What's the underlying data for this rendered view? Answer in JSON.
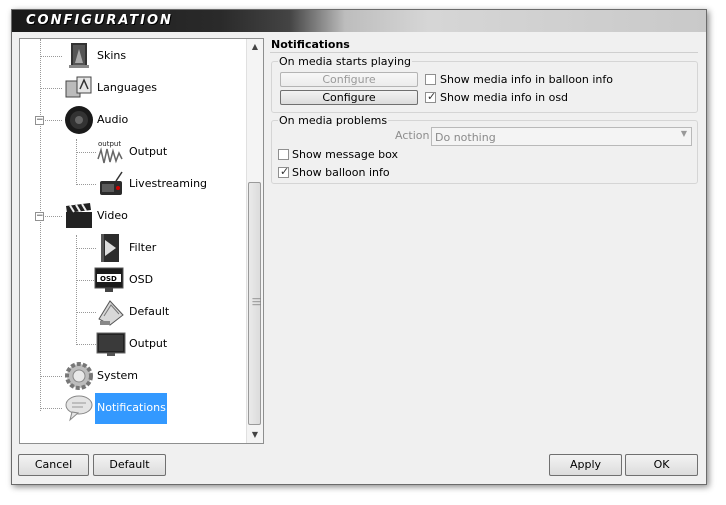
{
  "window": {
    "title": "CONFIGURATION"
  },
  "tree": {
    "items": [
      {
        "label": "Skins",
        "icon": "skins-icon"
      },
      {
        "label": "Languages",
        "icon": "languages-icon"
      },
      {
        "label": "Audio",
        "icon": "speaker-icon"
      },
      {
        "label": "Output",
        "icon": "audio-output-icon",
        "icon_text": "output"
      },
      {
        "label": "Livestreaming",
        "icon": "livestreaming-icon"
      },
      {
        "label": "Video",
        "icon": "clapperboard-icon"
      },
      {
        "label": "Filter",
        "icon": "filter-icon"
      },
      {
        "label": "OSD",
        "icon": "osd-icon",
        "icon_text": "OSD"
      },
      {
        "label": "Default",
        "icon": "default-icon"
      },
      {
        "label": "Output",
        "icon": "monitor-icon"
      },
      {
        "label": "System",
        "icon": "gear-icon"
      },
      {
        "label": "Notifications",
        "icon": "speech-bubble-icon"
      }
    ],
    "selected": "Notifications"
  },
  "notifications": {
    "title": "Notifications",
    "media_start": {
      "legend": "On media starts playing",
      "configure_label_1": "Configure",
      "configure_label_2": "Configure",
      "balloon_label": "Show media info in balloon info",
      "balloon_checked": false,
      "osd_label": "Show media info in osd",
      "osd_checked": true
    },
    "media_problems": {
      "legend": "On media problems",
      "action_label": "Action",
      "action_value": "Do nothing",
      "message_box_label": "Show message box",
      "message_box_checked": false,
      "balloon_label": "Show balloon info",
      "balloon_checked": true
    }
  },
  "footer": {
    "cancel_label": "Cancel",
    "default_label": "Default",
    "apply_label": "Apply",
    "ok_label": "OK"
  }
}
